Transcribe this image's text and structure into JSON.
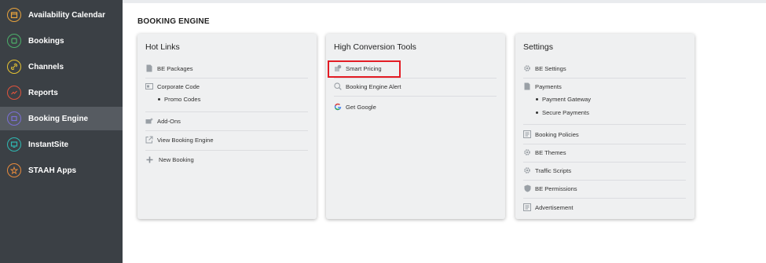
{
  "sidebar": {
    "items": [
      {
        "label": "Availability Calendar",
        "icon": "calendar-icon",
        "color": "#e8a33d"
      },
      {
        "label": "Bookings",
        "icon": "bookings-icon",
        "color": "#4caf6a"
      },
      {
        "label": "Channels",
        "icon": "link-icon",
        "color": "#e6c332"
      },
      {
        "label": "Reports",
        "icon": "chart-icon",
        "color": "#e0533d"
      },
      {
        "label": "Booking Engine",
        "icon": "booking-engine-icon",
        "color": "#7a6fd6",
        "active": true
      },
      {
        "label": "InstantSite",
        "icon": "monitor-icon",
        "color": "#2fb9b3"
      },
      {
        "label": "STAAH Apps",
        "icon": "apps-icon",
        "color": "#e78a3c"
      }
    ]
  },
  "page": {
    "title": "BOOKING ENGINE"
  },
  "hot_links": {
    "title": "Hot Links",
    "items": [
      "BE Packages",
      "Corporate Code",
      "Add-Ons",
      "View Booking Engine",
      "New Booking"
    ],
    "corporate_sub": [
      "Promo Codes"
    ]
  },
  "conversion": {
    "title": "High Conversion Tools",
    "items": [
      "Smart Pricing",
      "Booking Engine Alert",
      "Get Google"
    ]
  },
  "settings": {
    "title": "Settings",
    "items": [
      "BE Settings",
      "Payments",
      "Booking Policies",
      "BE Themes",
      "Traffic Scripts",
      "BE Permissions",
      "Advertisement"
    ],
    "payments_sub": [
      "Payment Gateway",
      "Secure Payments"
    ]
  },
  "colors": {
    "sidebar_bg": "#3b4045",
    "active_bg": "#565b61",
    "card_bg": "#eff0f1",
    "highlight": "#e31c24"
  }
}
